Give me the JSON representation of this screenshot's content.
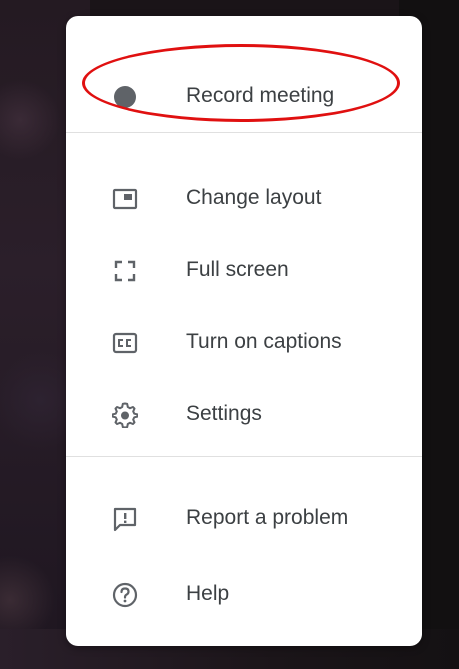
{
  "menu": {
    "items": [
      {
        "id": "record",
        "label": "Record meeting",
        "icon": "record-dot-icon"
      },
      {
        "id": "layout",
        "label": "Change layout",
        "icon": "layout-icon"
      },
      {
        "id": "fullscreen",
        "label": "Full screen",
        "icon": "fullscreen-icon"
      },
      {
        "id": "captions",
        "label": "Turn on captions",
        "icon": "captions-icon"
      },
      {
        "id": "settings",
        "label": "Settings",
        "icon": "gear-icon"
      },
      {
        "id": "report",
        "label": "Report a problem",
        "icon": "report-feedback-icon"
      },
      {
        "id": "help",
        "label": "Help",
        "icon": "help-circle-icon"
      }
    ]
  },
  "colors": {
    "menu_bg": "#ffffff",
    "text": "#3c4043",
    "icon": "#5f6368",
    "divider": "#e0e0e0",
    "annotation_ring": "#e01010"
  }
}
